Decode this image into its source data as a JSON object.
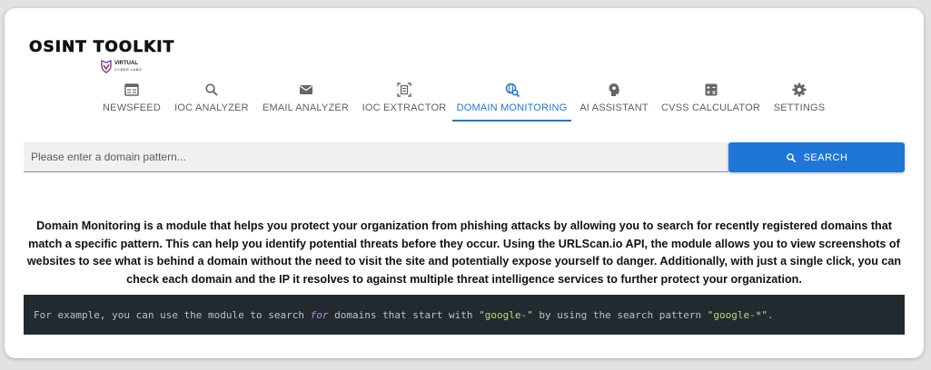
{
  "app": {
    "logo_title": "OSINT TOOLKIT",
    "logo_sub_title": "VIRTUAL",
    "logo_sub_caption": "CYBER LABS"
  },
  "nav": {
    "tabs": [
      {
        "label": "NEWSFEED",
        "icon": "newspaper-icon"
      },
      {
        "label": "IOC ANALYZER",
        "icon": "search-icon"
      },
      {
        "label": "EMAIL ANALYZER",
        "icon": "mail-icon"
      },
      {
        "label": "IOC EXTRACTOR",
        "icon": "document-scan-icon"
      },
      {
        "label": "DOMAIN MONITORING",
        "icon": "domain-search-icon",
        "active": true
      },
      {
        "label": "AI ASSISTANT",
        "icon": "brain-head-icon"
      },
      {
        "label": "CVSS CALCULATOR",
        "icon": "calculator-icon"
      },
      {
        "label": "SETTINGS",
        "icon": "gear-icon"
      }
    ]
  },
  "search": {
    "placeholder": "Please enter a domain pattern...",
    "value": "",
    "button_label": "SEARCH"
  },
  "description": "Domain Monitoring is a module that helps you protect your organization from phishing attacks by allowing you to search for recently registered domains that match a specific pattern. This can help you identify potential threats before they occur. Using the URLScan.io API, the module allows you to view screenshots of websites to see what is behind a domain without the need to visit the site and potentially expose yourself to danger. Additionally, with just a single click, you can check each domain and the IP it resolves to against multiple threat intelligence services to further protect your organization.",
  "example": {
    "part1": "For example, you can use the module to search ",
    "keyword": "for",
    "part2": " domains that start with ",
    "string1": "\"google-\"",
    "part3": " by using the search pattern ",
    "string2": "\"google-*\"",
    "part4": "."
  },
  "colors": {
    "accent": "#1e76d6",
    "code_background": "#222a30",
    "code_keyword": "#b58fd8",
    "code_string": "#b4d97e"
  }
}
